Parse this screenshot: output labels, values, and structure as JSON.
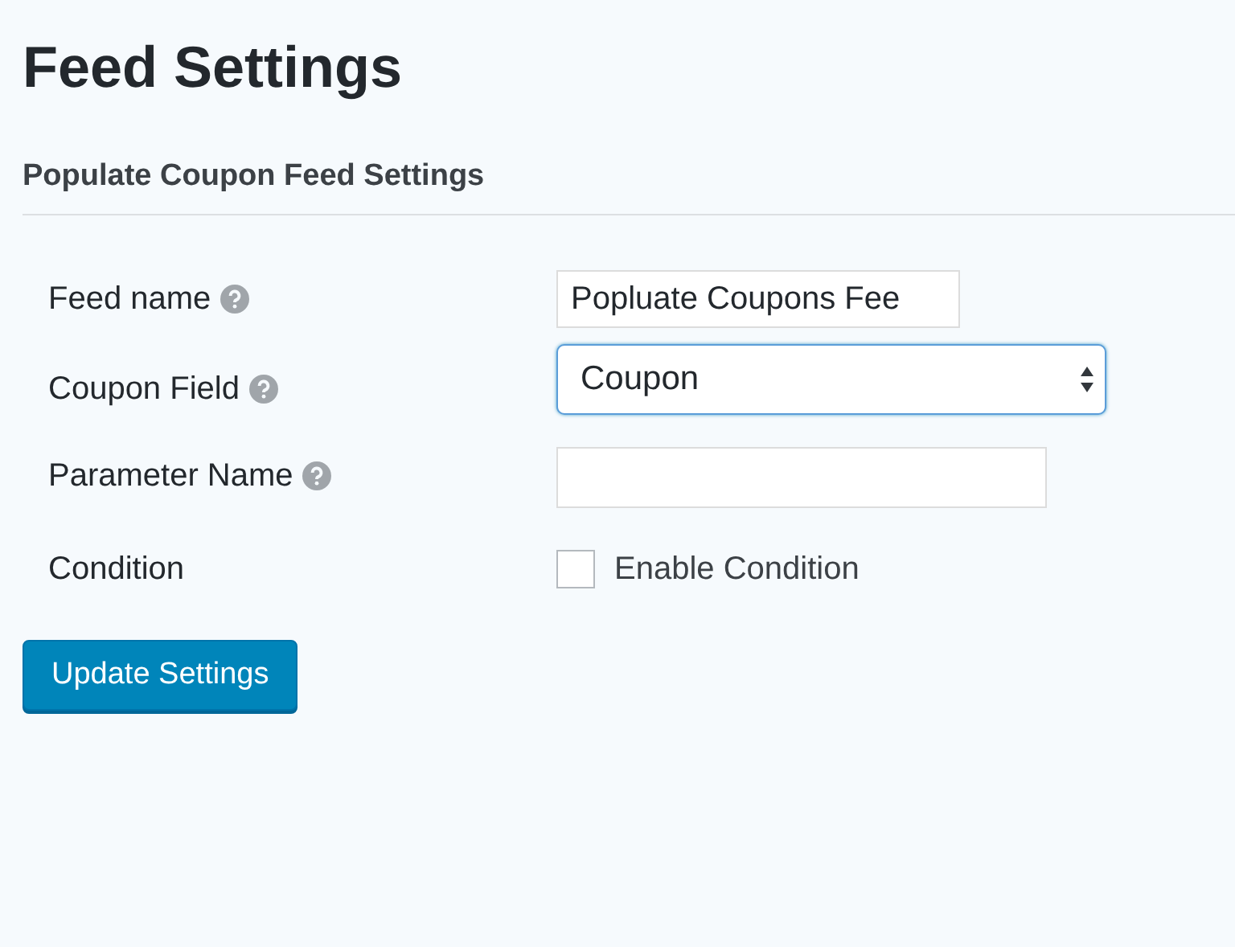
{
  "page_title": "Feed Settings",
  "section_title": "Populate Coupon Feed Settings",
  "fields": [
    {
      "kind": "text",
      "label": "Feed name",
      "help": true,
      "value": "Popluate Coupons Fee"
    },
    {
      "kind": "select",
      "label": "Coupon Field",
      "help": true,
      "value": "Coupon",
      "focused": true
    },
    {
      "kind": "text",
      "label": "Parameter Name",
      "help": true
    },
    {
      "kind": "checkbox",
      "label": "Condition",
      "help": false,
      "option": "Enable Condition",
      "checked": false
    }
  ],
  "submit": "Update Settings"
}
